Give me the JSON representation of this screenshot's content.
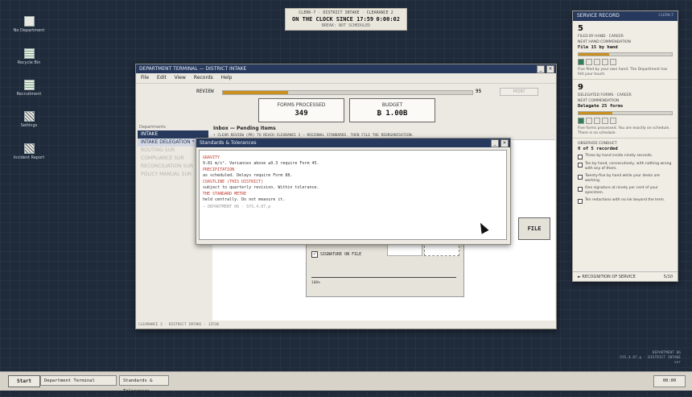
{
  "desktop": {
    "icons": [
      {
        "label": "No Department",
        "icon": "document-icon"
      },
      {
        "label": "Recycle Bin",
        "icon": "recycle-bin-icon"
      },
      {
        "label": "Recruitment",
        "icon": "recruitment-icon"
      },
      {
        "label": "Settings",
        "icon": "settings-icon"
      },
      {
        "label": "Incident Report",
        "icon": "incident-report-icon"
      }
    ]
  },
  "clock": {
    "line1": "CLERK-7 · DISTRICT INTAKE · CLEARANCE 2",
    "label": "ON THE CLOCK SINCE 17:59",
    "timer": "0:00:02",
    "break": "BREAK: NOT SCHEDULED"
  },
  "main_window": {
    "title": "DEPARTMENT TERMINAL — DISTRICT INTAKE",
    "menu": [
      "File",
      "Edit",
      "View",
      "Records",
      "Help"
    ],
    "review_label": "REVIEW",
    "review_value": "95",
    "review_fraction": 0.26,
    "print_label": "PRINT",
    "forms_processed_label": "FORMS PROCESSED",
    "forms_processed_value": "349",
    "budget_label": "BUDGET",
    "budget_value": "₿ 1.00B",
    "departments_header": "Departments",
    "departments": [
      {
        "label": "INTAKE",
        "state": "active"
      },
      {
        "label": "INTAKE DELEGATION *",
        "state": "selected"
      },
      {
        "label": "ROUTING",
        "extra": "SUR",
        "state": "disabled"
      },
      {
        "label": "COMPLIANCE",
        "extra": "SUR",
        "state": "disabled"
      },
      {
        "label": "RECONCILIATION",
        "extra": "SUR",
        "state": "disabled"
      },
      {
        "label": "POLICY MANUAL",
        "extra": "SUR",
        "state": "disabled"
      }
    ],
    "inbox_title": "Inbox — Pending Items",
    "inbox_subtitle": "• CLEAR REVIEW (PR) TO REACH CLEARANCE 2 — REGIONAL STANDARDS. THEN FILE THE REORGANISATION.",
    "signature_label": "SIGNATURE ON FILE",
    "signature_checked": true,
    "form_percent": "100%",
    "file_button": "FILE",
    "status_line": "CLEARANCE 2 · DISTRICT INTAKE · 12536"
  },
  "standards_dialog": {
    "title": "Standards & Tolerances",
    "entries": [
      {
        "heading": "GRAVITY",
        "text": "9.81 m/s². Variances above ±0.3 require Form 45."
      },
      {
        "heading": "PRECIPITATION",
        "text": "as scheduled. Delays require Form 88."
      },
      {
        "heading": "COASTLINE (THIS DISTRICT)",
        "text": "subject to quarterly revision. Within tolerance."
      },
      {
        "heading": "THE STANDARD METRE",
        "text": "held centrally. Do not measure it."
      }
    ],
    "footer": "— DEPARTMENT 06 · SYS.4.07.p"
  },
  "service_record": {
    "title": "SERVICE RECORD",
    "clerk": "CLERK-7",
    "filed_count": "5",
    "filed_label": "FILED BY HAND · CAREER",
    "next_hand_label": "NEXT HAND COMMENDATION",
    "next_hand_value": "File 15 by hand",
    "hand_progress_fraction": 0.33,
    "hand_dots_on": 1,
    "hand_note": "Five filed by your own hand. The Department has felt your touch.",
    "delegated_count": "9",
    "delegated_label": "DELEGATED FORMS · CAREER",
    "next_commendation_label": "NEXT COMMENDATION",
    "next_commendation_value": "Delegate 25 forms",
    "delegate_progress_fraction": 0.36,
    "delegate_dots_on": 1,
    "delegate_note": "Five forms processed. You are exactly on schedule. There is no schedule.",
    "observed_label": "OBSERVED CONDUCT",
    "observed_value": "0 of 5 recorded",
    "conduct": [
      "Three by hand inside ninety seconds.",
      "Ten by hand, consecutively, with nothing wrong with any of them.",
      "Twenty-five by hand while your desks are working.",
      "One signature at ninety per cent of your specimen.",
      "Ten redactions with no ink beyond the term."
    ],
    "recognition_label": "► RECOGNITION OF SERVICE",
    "recognition_value": "5/10"
  },
  "taskbar": {
    "start": "Start",
    "tasks": [
      "Department Terminal",
      "Standards & Tolerances"
    ],
    "tray": "00:00"
  },
  "footer_info": {
    "line1": "DEPARTMENT 06",
    "line2": "SYS.4.07.p · DISTRICT INTAKE",
    "line3": "ver"
  },
  "colors": {
    "desktop": "#1f2a3a",
    "titlebar": "#273a5e",
    "accent": "#c9901e",
    "ok": "#2f7d5a",
    "warn": "#c0392b"
  }
}
